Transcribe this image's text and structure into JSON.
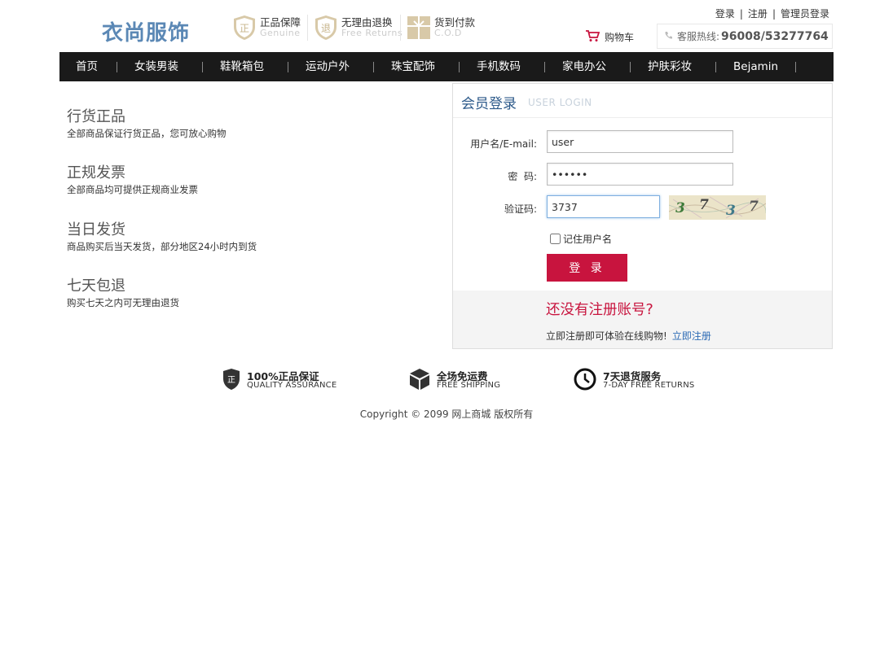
{
  "brand": {
    "logo_text": "衣尚服饰"
  },
  "promos": [
    {
      "icon": "genuine-shield-icon",
      "icon_char": "正",
      "title": "正品保障",
      "subtitle": "Genuine"
    },
    {
      "icon": "return-shield-icon",
      "icon_char": "退",
      "title": "无理由退换",
      "subtitle": "Free Returns"
    },
    {
      "icon": "gift-box-icon",
      "icon_char": "米",
      "title": "货到付款",
      "subtitle": "C.O.D"
    }
  ],
  "top_links": {
    "login": "登录",
    "register": "注册",
    "admin_login": "管理员登录",
    "separator": "|"
  },
  "cart": {
    "label": "购物车"
  },
  "hotline": {
    "label": "客服热线:",
    "number": "96008/53277764"
  },
  "nav": {
    "items": [
      "首页",
      "女装男装",
      "鞋靴箱包",
      "运动户外",
      "珠宝配饰",
      "手机数码",
      "家电办公",
      "护肤彩妆",
      "Bejamin"
    ]
  },
  "features": [
    {
      "title": "行货正品",
      "desc": "全部商品保证行货正品，您可放心购物"
    },
    {
      "title": "正规发票",
      "desc": "全部商品均可提供正规商业发票"
    },
    {
      "title": "当日发货",
      "desc": "商品购买后当天发货，部分地区24小时内到货"
    },
    {
      "title": "七天包退",
      "desc": "购买七天之内可无理由退货"
    }
  ],
  "login": {
    "title": "会员登录",
    "title_en": "USER LOGIN",
    "username_label": "用户名/E-mail:",
    "username_value": "user",
    "password_label": "密  码:",
    "password_value": "••••••",
    "captcha_label": "验证码:",
    "captcha_value": "3737",
    "captcha_text": "3737",
    "remember_label": "记住用户名",
    "submit_label": "登 录",
    "no_account_title": "还没有注册账号?",
    "register_hint": "立即注册即可体验在线购物!",
    "register_link": "立即注册"
  },
  "services": [
    {
      "icon": "quality-shield-icon",
      "title": "100%正品保证",
      "subtitle": "QUALITY ASSURANCE"
    },
    {
      "icon": "box-icon",
      "title": "全场免运费",
      "subtitle": "FREE SHIPPING"
    },
    {
      "icon": "clock-icon",
      "title": "7天退货服务",
      "subtitle": "7-DAY FREE RETURNS"
    }
  ],
  "copyright": "Copyright © 2099 网上商城 版权所有",
  "colors": {
    "accent_red": "#c8143e",
    "nav_bg": "#1a1a1a",
    "logo_blue": "#5b88b5",
    "link_blue": "#2d6bb5"
  }
}
